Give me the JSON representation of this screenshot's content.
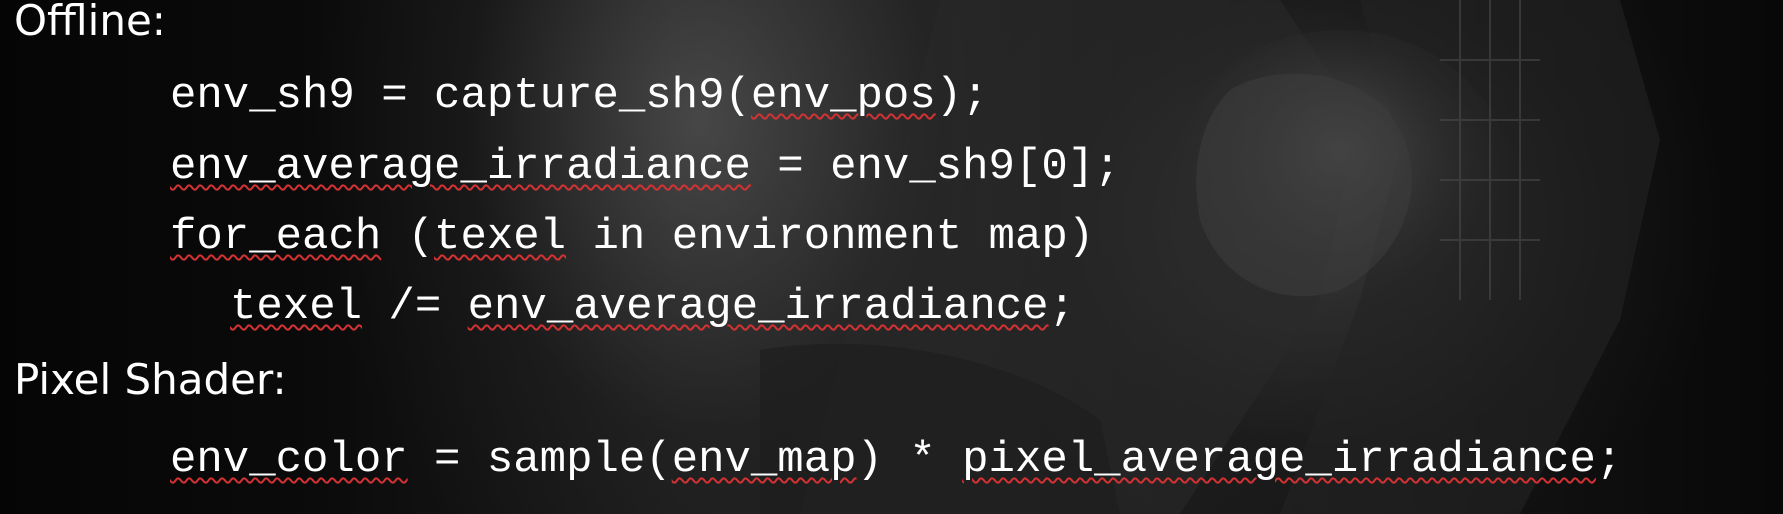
{
  "sections": {
    "offline": {
      "heading": "Offline:",
      "line1": {
        "a": "env_sh9 = capture_sh9(",
        "b": "env_pos",
        "c": ");"
      },
      "line2": {
        "a": "env_average_irradiance",
        "b": " = env_sh9[0];"
      },
      "line3": {
        "a": "for_each",
        "b": " (",
        "c": "texel",
        "d": " in environment map)"
      },
      "line4": {
        "a": "texel",
        "b": " /= ",
        "c": "env_average_irradiance",
        "d": ";"
      }
    },
    "pixel_shader": {
      "heading": "Pixel Shader:",
      "line1": {
        "a": "env_color",
        "b": " = sample(",
        "c": "env_map",
        "d": ") * ",
        "e": "pixel_average_irradiance",
        "f": ";"
      }
    }
  },
  "colors": {
    "text": "#ffffff",
    "spellcheck_underline": "#d23232",
    "background": "#101010"
  }
}
